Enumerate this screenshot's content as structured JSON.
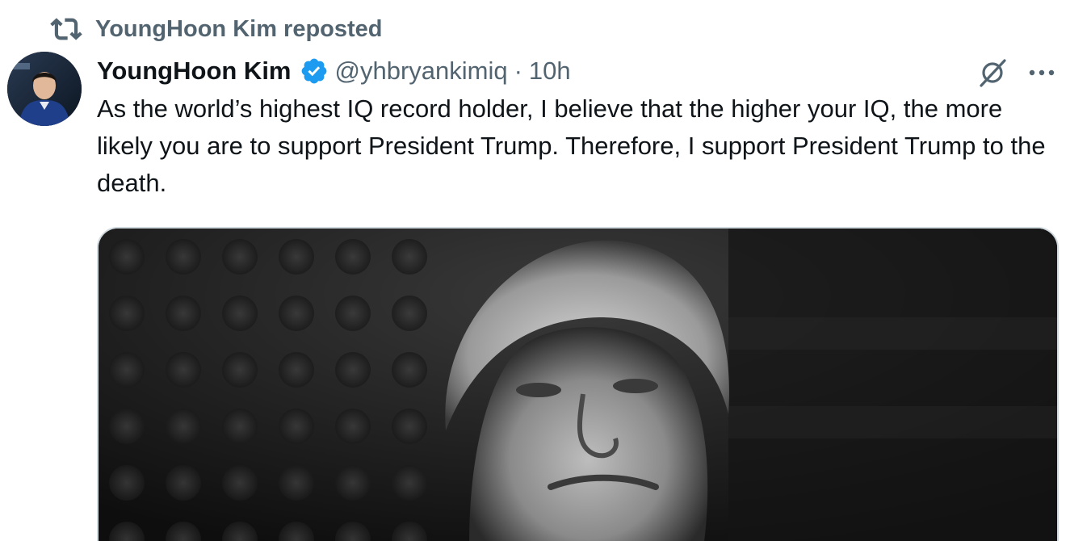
{
  "repost_banner": {
    "icon": "repost-icon",
    "text": "YoungHoon Kim reposted"
  },
  "author": {
    "avatar_icon": "avatar",
    "name": "YoungHoon Kim",
    "verified_icon": "verified-badge-icon",
    "handle": "@yhbryankimiq",
    "separator": "·",
    "time": "10h"
  },
  "actions": {
    "grok_icon": "grok-icon",
    "more_icon": "more-options-icon"
  },
  "tweet": {
    "text": "As the world’s highest IQ record holder, I believe that the higher your IQ, the more likely you are to support President Trump. Therefore, I support President Trump to the death."
  },
  "media": {
    "type": "photo",
    "style": "black-and-white portrait"
  },
  "colors": {
    "text_primary": "#0f1419",
    "text_secondary": "#536471",
    "verified_blue": "#1d9bf0",
    "border": "#cfd9de"
  }
}
